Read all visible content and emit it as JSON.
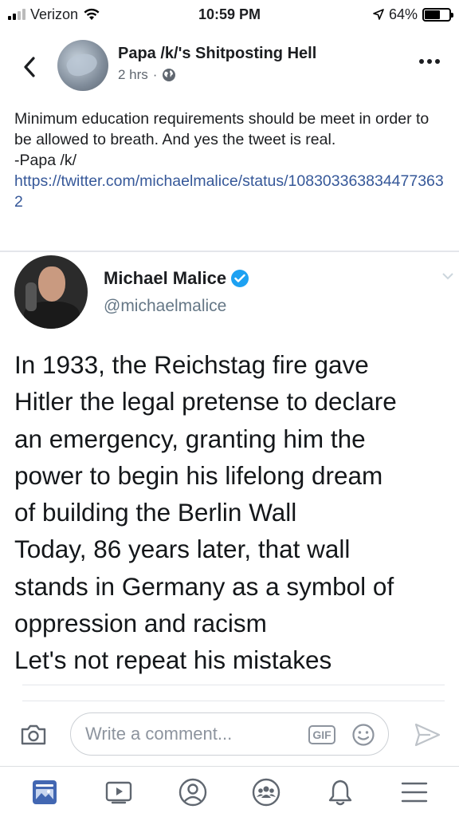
{
  "status_bar": {
    "carrier": "Verizon",
    "time": "10:59 PM",
    "battery_percent": "64%",
    "battery_level": 0.64,
    "icons": [
      "signal-icon",
      "wifi-icon",
      "location-arrow-icon",
      "battery-icon"
    ]
  },
  "post": {
    "page_name": "Papa /k/'s Shitposting Hell",
    "time_ago": "2 hrs",
    "separator": "·",
    "text_lines": [
      "Minimum education requirements should be meet in order to be allowed to breath. And yes the tweet is real.",
      "-Papa /k/"
    ],
    "link": "https://twitter.com/michaelmalice/status/1083033638344773632"
  },
  "tweet": {
    "author_name": "Michael Malice",
    "handle": "@michaelmalice",
    "verified": true,
    "body_lines": [
      "In 1933, the Reichstag fire gave",
      "Hitler the legal pretense to declare",
      "an emergency, granting him the",
      "power to begin his lifelong dream",
      "of building the Berlin Wall",
      "Today, 86 years later, that wall",
      "stands in Germany as a symbol of",
      "oppression and racism",
      "Let's not repeat his mistakes"
    ]
  },
  "comment_bar": {
    "placeholder": "Write a comment...",
    "gif_label": "GIF"
  },
  "tab_bar": {
    "tabs": [
      "news-feed-icon",
      "watch-icon",
      "profile-icon",
      "groups-icon",
      "notifications-icon",
      "menu-icon"
    ]
  },
  "colors": {
    "link": "#365899",
    "verified_blue": "#1da1f2",
    "feed_blue": "#4267b2",
    "muted_text": "#606770"
  }
}
